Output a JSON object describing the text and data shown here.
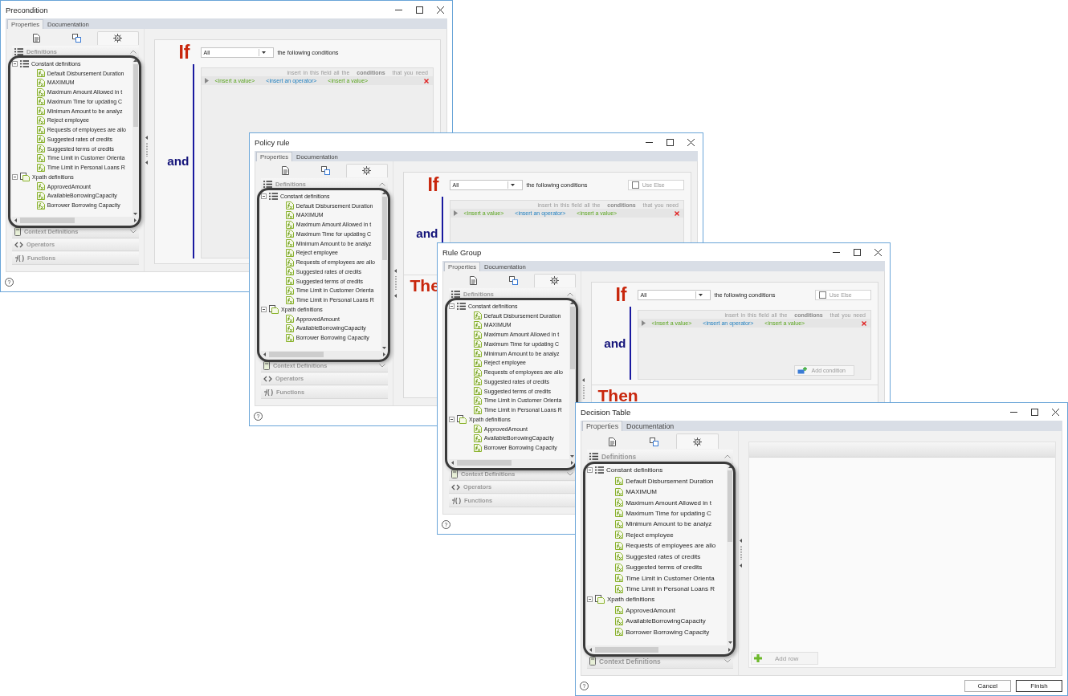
{
  "windows": [
    {
      "title": "Precondition",
      "tabs": [
        {
          "label": "Properties",
          "selected": true
        },
        {
          "label": "Documentation",
          "selected": false
        }
      ],
      "view_tabs": [
        {
          "kind": "document",
          "selected": false
        },
        {
          "kind": "linked",
          "selected": false
        },
        {
          "kind": "settings",
          "selected": true
        }
      ],
      "sections": [
        {
          "kind": "definitions",
          "label": "Definitions",
          "expanded": true
        },
        {
          "kind": "context",
          "label": "Context Definitions",
          "expanded": false
        },
        {
          "kind": "operators",
          "label": "Operators",
          "expanded": false
        },
        {
          "kind": "functions",
          "label": "Functions",
          "expanded": false
        }
      ],
      "tree": [
        {
          "kind": "constant",
          "label": "Constant definitions",
          "expanded": true,
          "children": [
            {
              "label": "Default Disbursement Duration"
            },
            {
              "label": "MAXIMUM"
            },
            {
              "label": "Maximum Amount Allowed in t"
            },
            {
              "label": "Maximum Time for updating C"
            },
            {
              "label": "Minimum Amount to be analyz"
            },
            {
              "label": "Reject employee"
            },
            {
              "label": "Requests of employees are allo"
            },
            {
              "label": "Suggested rates of credits"
            },
            {
              "label": "Suggested terms of credits"
            },
            {
              "label": "Time Limit in Customer Orienta"
            },
            {
              "label": "Time Limit in Personal Loans R"
            }
          ]
        },
        {
          "kind": "xpath",
          "label": "Xpath definitions",
          "expanded": true,
          "children": [
            {
              "label": "ApprovedAmount"
            },
            {
              "label": "AvailableBorrowingCapacity"
            },
            {
              "label": "Borrower Borrowing Capacity"
            }
          ]
        }
      ],
      "pane": {
        "kind": "rule",
        "keyword": "If",
        "match": "All",
        "match_suffix": "the following conditions",
        "hint": "insert in this field all the **conditions** that you need",
        "row": [
          {
            "kind": "value",
            "text": "<insert a value>"
          },
          {
            "kind": "operator",
            "text": "<insert an operator>"
          },
          {
            "kind": "value",
            "text": "<insert a value>"
          }
        ],
        "connector": "and"
      },
      "help": "?"
    },
    {
      "title": "Policy rule",
      "tabs": [
        {
          "label": "Properties",
          "selected": true
        },
        {
          "label": "Documentation",
          "selected": false
        }
      ],
      "view_tabs": [
        {
          "kind": "document",
          "selected": false
        },
        {
          "kind": "linked",
          "selected": false
        },
        {
          "kind": "settings",
          "selected": true
        }
      ],
      "sections": [
        {
          "kind": "definitions",
          "label": "Definitions",
          "expanded": true
        },
        {
          "kind": "context",
          "label": "Context Definitions",
          "expanded": false
        },
        {
          "kind": "operators",
          "label": "Operators",
          "expanded": false
        },
        {
          "kind": "functions",
          "label": "Functions",
          "expanded": false
        }
      ],
      "tree": [
        {
          "kind": "constant",
          "label": "Constant definitions",
          "expanded": true,
          "children": [
            {
              "label": "Default Disbursement Duration"
            },
            {
              "label": "MAXIMUM"
            },
            {
              "label": "Maximum Amount Allowed in t"
            },
            {
              "label": "Maximum Time for updating C"
            },
            {
              "label": "Minimum Amount to be analyz"
            },
            {
              "label": "Reject employee"
            },
            {
              "label": "Requests of employees are allo"
            },
            {
              "label": "Suggested rates of credits"
            },
            {
              "label": "Suggested terms of credits"
            },
            {
              "label": "Time Limit in Customer Orienta"
            },
            {
              "label": "Time Limit in Personal Loans R"
            }
          ]
        },
        {
          "kind": "xpath",
          "label": "Xpath definitions",
          "expanded": true,
          "children": [
            {
              "label": "ApprovedAmount"
            },
            {
              "label": "AvailableBorrowingCapacity"
            },
            {
              "label": "Borrower Borrowing Capacity"
            }
          ]
        }
      ],
      "pane": {
        "kind": "rule",
        "keyword": "If",
        "match": "All",
        "match_suffix": "the following conditions",
        "use_else": {
          "label": "Use Else",
          "checked": false
        },
        "hint": "insert in this field all the **conditions** that you need",
        "row": [
          {
            "kind": "value",
            "text": "<insert a value>"
          },
          {
            "kind": "operator",
            "text": "<insert an operator>"
          },
          {
            "kind": "value",
            "text": "<insert a value>"
          }
        ],
        "connector": "and",
        "then": "The"
      },
      "help": "?"
    },
    {
      "title": "Rule Group",
      "tabs": [
        {
          "label": "Properties",
          "selected": true
        },
        {
          "label": "Documentation",
          "selected": false
        }
      ],
      "view_tabs": [
        {
          "kind": "document",
          "selected": false
        },
        {
          "kind": "linked",
          "selected": false
        },
        {
          "kind": "settings",
          "selected": true
        }
      ],
      "sections": [
        {
          "kind": "definitions",
          "label": "Definitions",
          "expanded": true
        },
        {
          "kind": "context",
          "label": "Context Definitions",
          "expanded": false
        },
        {
          "kind": "operators",
          "label": "Operators",
          "expanded": false
        },
        {
          "kind": "functions",
          "label": "Functions",
          "expanded": false
        }
      ],
      "tree": [
        {
          "kind": "constant",
          "label": "Constant definitions",
          "expanded": true,
          "children": [
            {
              "label": "Default Disbursement Duration"
            },
            {
              "label": "MAXIMUM"
            },
            {
              "label": "Maximum Amount Allowed in t"
            },
            {
              "label": "Maximum Time for updating C"
            },
            {
              "label": "Minimum Amount to be analyz"
            },
            {
              "label": "Reject employee"
            },
            {
              "label": "Requests of employees are allo"
            },
            {
              "label": "Suggested rates of credits"
            },
            {
              "label": "Suggested terms of credits"
            },
            {
              "label": "Time Limit in Customer Orienta"
            },
            {
              "label": "Time Limit in Personal Loans R"
            }
          ]
        },
        {
          "kind": "xpath",
          "label": "Xpath definitions",
          "expanded": true,
          "children": [
            {
              "label": "ApprovedAmount"
            },
            {
              "label": "AvailableBorrowingCapacity"
            },
            {
              "label": "Borrower Borrowing Capacity"
            }
          ]
        }
      ],
      "pane": {
        "kind": "rule",
        "keyword": "If",
        "match": "All",
        "match_suffix": "the following conditions",
        "use_else": {
          "label": "Use Else",
          "checked": false
        },
        "hint": "insert in this field all the **conditions** that you need",
        "row": [
          {
            "kind": "value",
            "text": "<insert a value>"
          },
          {
            "kind": "operator",
            "text": "<insert an operator>"
          },
          {
            "kind": "value",
            "text": "<insert a value>"
          }
        ],
        "connector": "and",
        "add_condition": "Add condition",
        "then": "Then"
      },
      "help": "?"
    },
    {
      "title": "Decision Table",
      "tabs": [
        {
          "label": "Properties",
          "selected": true
        },
        {
          "label": "Documentation",
          "selected": false
        }
      ],
      "view_tabs": [
        {
          "kind": "document",
          "selected": false
        },
        {
          "kind": "linked",
          "selected": false
        },
        {
          "kind": "settings",
          "selected": true
        }
      ],
      "sections": [
        {
          "kind": "definitions",
          "label": "Definitions",
          "expanded": true
        },
        {
          "kind": "context",
          "label": "Context Definitions",
          "expanded": false
        }
      ],
      "tree": [
        {
          "kind": "constant",
          "label": "Constant definitions",
          "expanded": true,
          "children": [
            {
              "label": "Default Disbursement Duration"
            },
            {
              "label": "MAXIMUM"
            },
            {
              "label": "Maximum Amount Allowed in t"
            },
            {
              "label": "Maximum Time for updating C"
            },
            {
              "label": "Minimum Amount to be analyz"
            },
            {
              "label": "Reject employee"
            },
            {
              "label": "Requests of employees are allo"
            },
            {
              "label": "Suggested rates of credits"
            },
            {
              "label": "Suggested terms of credits"
            },
            {
              "label": "Time Limit in Customer Orienta"
            },
            {
              "label": "Time Limit in Personal Loans R"
            }
          ]
        },
        {
          "kind": "xpath",
          "label": "Xpath definitions",
          "expanded": true,
          "children": [
            {
              "label": "ApprovedAmount"
            },
            {
              "label": "AvailableBorrowingCapacity"
            },
            {
              "label": "Borrower Borrowing Capacity"
            }
          ]
        }
      ],
      "pane": {
        "kind": "table",
        "add_row": "Add row"
      },
      "help": "?",
      "buttons": [
        {
          "label": "Cancel",
          "default": false
        },
        {
          "label": "Finish",
          "default": true
        }
      ]
    }
  ]
}
